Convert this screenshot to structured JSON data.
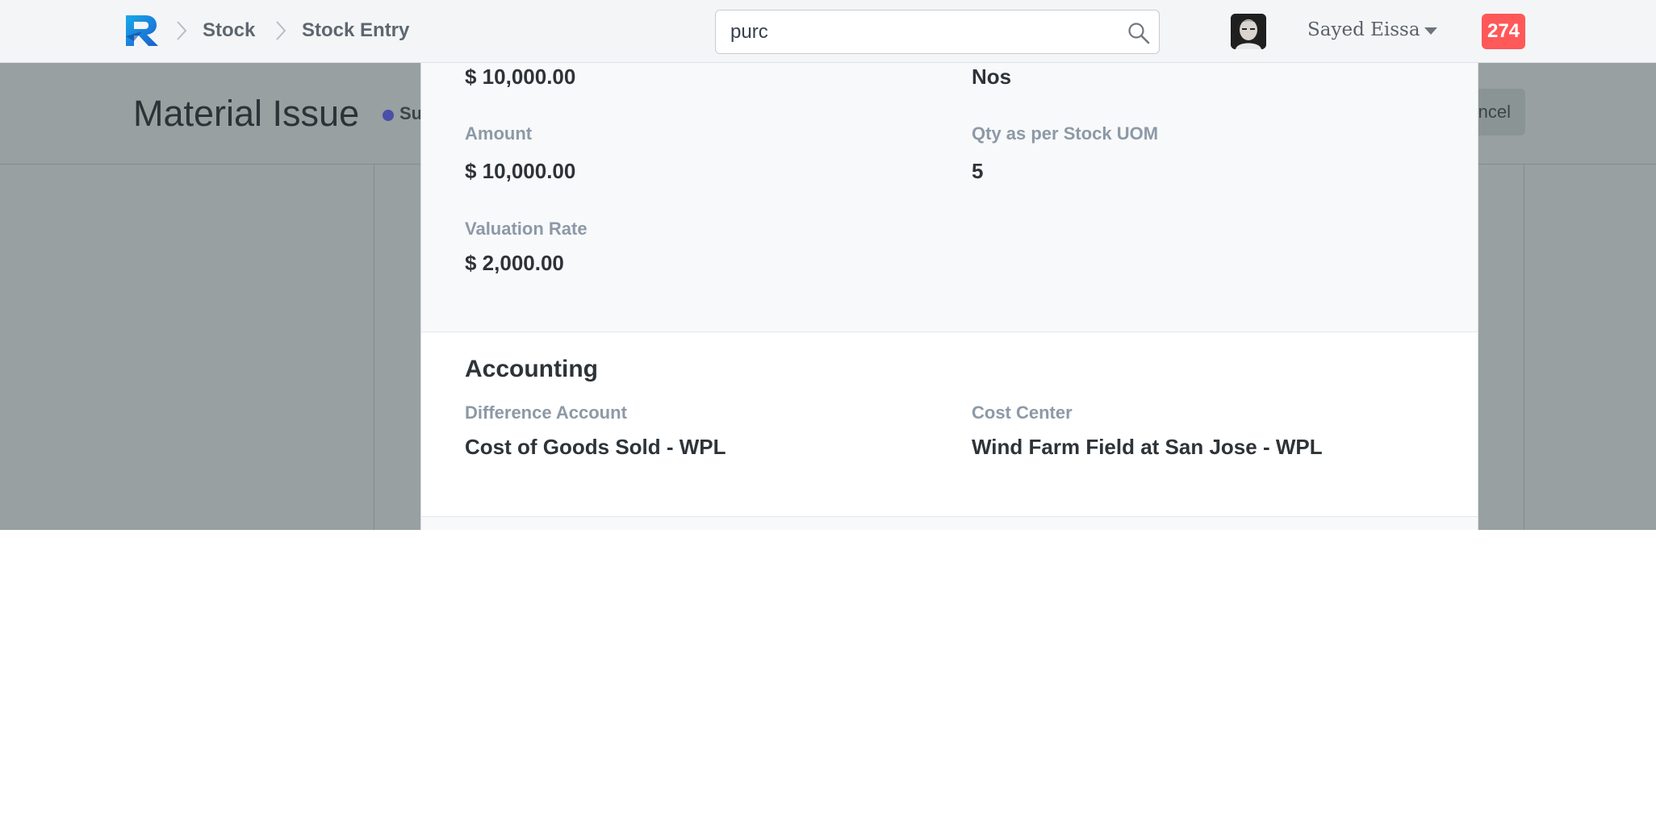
{
  "navbar": {
    "breadcrumbs": [
      "Stock",
      "Stock Entry"
    ],
    "search_value": "purc",
    "user_name": "Sayed Eissa",
    "notification_count": "274"
  },
  "page": {
    "title": "Material Issue",
    "status": "Su",
    "cancel_label": "ncel",
    "status_color": "#4a4fa8"
  },
  "modal": {
    "rate_value": "$ 10,000.00",
    "uom_value": "Nos",
    "amount_label": "Amount",
    "amount_value": "$ 10,000.00",
    "qty_stock_uom_label": "Qty as per Stock UOM",
    "qty_stock_uom_value": "5",
    "valuation_rate_label": "Valuation Rate",
    "valuation_rate_value": "$ 2,000.00",
    "accounting": {
      "title": "Accounting",
      "difference_account_label": "Difference Account",
      "difference_account_value": "Cost of Goods Sold - WPL",
      "cost_center_label": "Cost Center",
      "cost_center_value": "Wind Farm Field at San Jose - WPL"
    }
  },
  "colors": {
    "badge": "#ff5858",
    "overlay": "#98a0a1",
    "logo_blue": "#1a6fd8"
  }
}
